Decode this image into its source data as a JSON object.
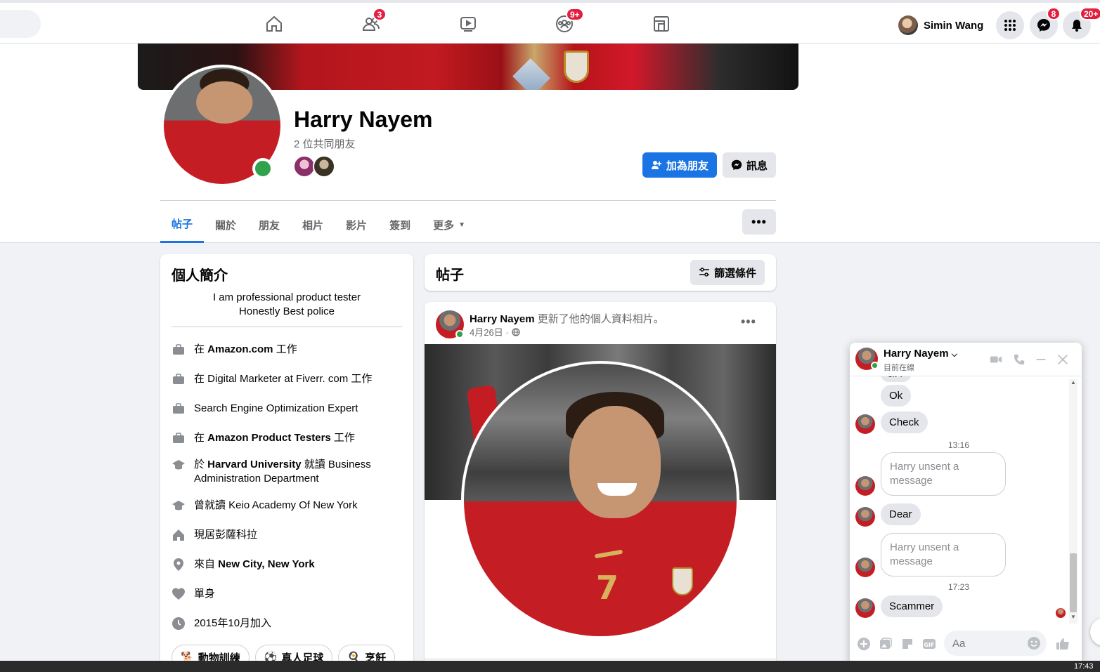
{
  "topbar": {
    "friends_badge": "3",
    "groups_badge": "9+",
    "user_name": "Simin Wang",
    "messenger_badge": "8",
    "notifications_badge": "20+"
  },
  "profile": {
    "name": "Harry Nayem",
    "mutual_friends": "2 位共同朋友",
    "add_friend_label": "加為朋友",
    "message_label": "訊息"
  },
  "tabs": [
    {
      "label": "帖子"
    },
    {
      "label": "關於"
    },
    {
      "label": "朋友"
    },
    {
      "label": "相片"
    },
    {
      "label": "影片"
    },
    {
      "label": "簽到"
    },
    {
      "label": "更多"
    }
  ],
  "intro": {
    "title": "個人簡介",
    "bio_line1": "I am professional product tester",
    "bio_line2": "Honestly Best police",
    "items": [
      {
        "prefix": "在 ",
        "bold": "Amazon.com",
        "suffix": " 工作"
      },
      {
        "prefix": "在 Digital Marketer at Fiverr. com 工作",
        "bold": "",
        "suffix": ""
      },
      {
        "prefix": "Search Engine Optimization Expert",
        "bold": "",
        "suffix": ""
      },
      {
        "prefix": "在 ",
        "bold": "Amazon Product Testers",
        "suffix": " 工作"
      },
      {
        "prefix": "於 ",
        "bold": "Harvard University",
        "suffix": " 就讀 Business Administration Department"
      },
      {
        "prefix": "曾就讀 Keio Academy Of New York",
        "bold": "",
        "suffix": ""
      },
      {
        "prefix": "現居彭薩科拉",
        "bold": "",
        "suffix": ""
      },
      {
        "prefix": "來自 ",
        "bold": "New City, New York",
        "suffix": ""
      },
      {
        "prefix": "單身",
        "bold": "",
        "suffix": ""
      },
      {
        "prefix": "2015年10月加入",
        "bold": "",
        "suffix": ""
      }
    ],
    "hobbies": [
      "動物訓練",
      "真人足球",
      "烹飪"
    ]
  },
  "posts": {
    "title": "帖子",
    "filter_label": "篩選條件",
    "post_author": "Harry Nayem",
    "post_action": " 更新了他的個人資料相片。",
    "post_date": "4月26日 ·"
  },
  "chat": {
    "name": "Harry Nayem",
    "status": "目前在線",
    "msg_ok_partial": "ok ?",
    "msg_ok": "Ok",
    "msg_check": "Check",
    "time1": "13:16",
    "unsent1": "Harry unsent a message",
    "msg_dear": "Dear",
    "unsent2": "Harry unsent a message",
    "time2": "17:23",
    "msg_scammer": "Scammer",
    "input_placeholder": "Aa"
  },
  "taskbar": {
    "clock": "17:43"
  }
}
